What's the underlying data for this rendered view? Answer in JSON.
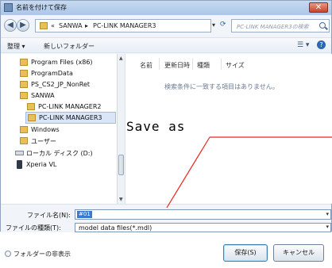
{
  "window": {
    "title": "名前を付けて保存",
    "close_glyph": "✕"
  },
  "address": {
    "back_glyph": "◀",
    "forward_glyph": "▶",
    "prefix": "«",
    "segments": [
      "SANWA",
      "PC-LINK MANAGER3"
    ],
    "separator": "▸",
    "dropdown_glyph": "▾",
    "refresh_glyph": "⟳",
    "search_placeholder": "PC-LINK MANAGER3の検索"
  },
  "toolbar": {
    "organize": "整理 ▾",
    "new_folder": "新しいフォルダー",
    "view_glyph": "☰ ▾",
    "help_glyph": "?"
  },
  "nav": {
    "items": [
      {
        "label": "Program Files (x86)",
        "icon": "folder-icon"
      },
      {
        "label": "ProgramData",
        "icon": "folder-icon"
      },
      {
        "label": "PS_CS2_JP_NonRet",
        "icon": "folder-icon"
      },
      {
        "label": "SANWA",
        "icon": "folder-icon"
      },
      {
        "label": "PC-LINK MANAGER2",
        "icon": "folder-icon"
      },
      {
        "label": "PC-LINK MANAGER3",
        "icon": "folder-icon",
        "selected": true
      },
      {
        "label": "Windows",
        "icon": "folder-icon"
      },
      {
        "label": "ユーザー",
        "icon": "folder-icon"
      },
      {
        "label": "ローカル ディスク (D:)",
        "icon": "drive-icon"
      },
      {
        "label": "Xperia VL",
        "icon": "phone-icon"
      }
    ],
    "scroll_up_glyph": "▲",
    "scroll_down_glyph": "▼"
  },
  "filelist": {
    "columns": [
      "名前",
      "更新日時",
      "種類",
      "サイズ"
    ],
    "empty_message": "検索条件に一致する項目はありません。"
  },
  "form": {
    "filename_label": "ファイル名(N):",
    "filename_value": "#01",
    "filetype_label": "ファイルの種類(T):",
    "filetype_value": "model data files(*.mdl)",
    "dropdown_glyph": "▾"
  },
  "footer": {
    "hide_folders": "フォルダーの非表示",
    "save_button": "保存(S)",
    "cancel_button": "キャンセル"
  },
  "annotation": {
    "text": "Save as",
    "line_color": "#e8261c"
  },
  "colors": {
    "selection": "#3a79d0",
    "window_bg": "#f1f4f8",
    "titlebar": "#aac6e8"
  }
}
